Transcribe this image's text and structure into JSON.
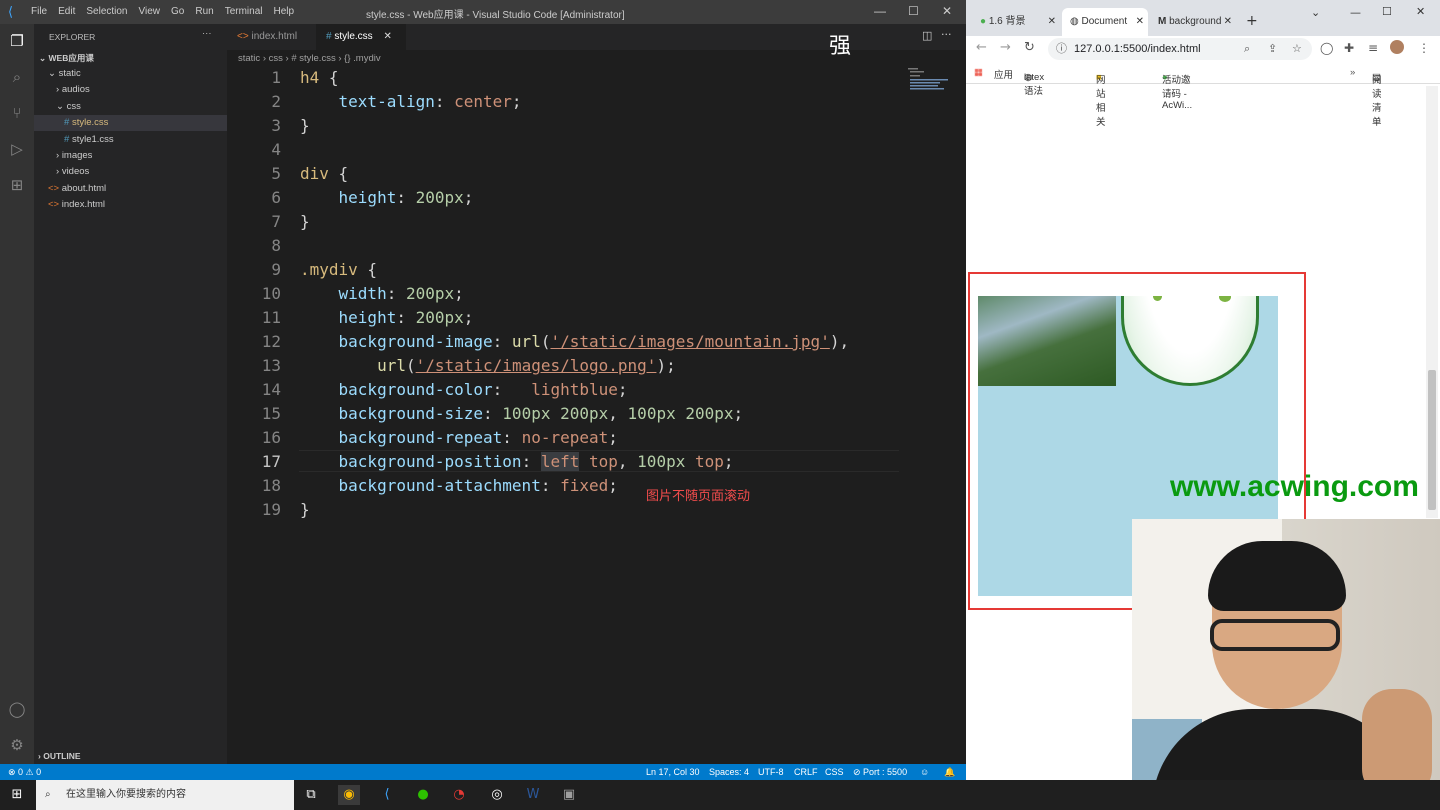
{
  "vscode": {
    "menu": [
      "File",
      "Edit",
      "Selection",
      "View",
      "Go",
      "Run",
      "Terminal",
      "Help"
    ],
    "window_title": "style.css - Web应用课 - Visual Studio Code [Administrator]",
    "explorer_title": "EXPLORER",
    "project": "WEB应用课",
    "tree": [
      {
        "label": "static",
        "indent": 1,
        "kind": "folder-open"
      },
      {
        "label": "audios",
        "indent": 2,
        "kind": "folder"
      },
      {
        "label": "css",
        "indent": 2,
        "kind": "folder-open"
      },
      {
        "label": "style.css",
        "indent": 3,
        "kind": "css",
        "selected": true
      },
      {
        "label": "style1.css",
        "indent": 3,
        "kind": "css"
      },
      {
        "label": "images",
        "indent": 2,
        "kind": "folder"
      },
      {
        "label": "videos",
        "indent": 2,
        "kind": "folder"
      },
      {
        "label": "about.html",
        "indent": 1,
        "kind": "html"
      },
      {
        "label": "index.html",
        "indent": 1,
        "kind": "html"
      }
    ],
    "outline": "OUTLINE",
    "tabs": [
      {
        "label": "index.html",
        "icon": "html-icon",
        "active": false
      },
      {
        "label": "style.css",
        "icon": "css-icon",
        "active": true
      }
    ],
    "breadcrumb": [
      "static",
      "css",
      "# style.css",
      "{} .mydiv"
    ],
    "ime_char": "强",
    "annotation": "图片不随页面滚动",
    "current_line": 17,
    "status": {
      "problems": "⊗ 0 ⚠ 0",
      "position": "Ln 17, Col 30",
      "spaces": "Spaces: 4",
      "encoding": "UTF-8",
      "eol": "CRLF",
      "lang": "CSS",
      "port": "⊘ Port : 5500"
    }
  },
  "code_lines": [
    "h4 {",
    "    text-align: center;",
    "}",
    "",
    "div {",
    "    height: 200px;",
    "}",
    "",
    ".mydiv {",
    "    width: 200px;",
    "    height: 200px;",
    "    background-image: url('/static/images/mountain.jpg'),",
    "        url('/static/images/logo.png');",
    "    background-color:   lightblue;",
    "    background-size: 100px 200px, 100px 200px;",
    "    background-repeat: no-repeat;",
    "    background-position: left top, 100px top;",
    "    background-attachment: fixed;",
    "}"
  ],
  "chrome": {
    "tabs": [
      "1.6 背景",
      "Document",
      "background"
    ],
    "url": "127.0.0.1:5500/index.html",
    "bookmarks": [
      "应用",
      "latex 语法",
      "网站相关",
      "活动邀请码 - AcWi...",
      "阅读清单"
    ],
    "watermark": "www.acwing.com"
  },
  "taskbar": {
    "search_placeholder": "在这里输入你要搜索的内容"
  },
  "colors": {
    "vscode_bg": "#1e1e1e",
    "status_blue": "#007acc",
    "demo_bg": "#add8e6",
    "highlight_red": "#e53935",
    "watermark_green": "#0a9a10"
  }
}
